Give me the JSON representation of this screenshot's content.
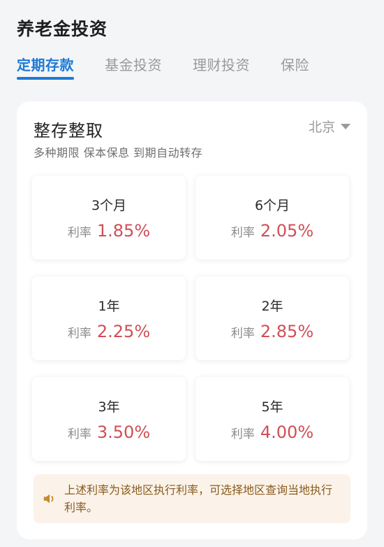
{
  "page": {
    "title": "养老金投资"
  },
  "tabs": [
    {
      "label": "定期存款",
      "active": true
    },
    {
      "label": "基金投资",
      "active": false
    },
    {
      "label": "理财投资",
      "active": false
    },
    {
      "label": "保险",
      "active": false
    }
  ],
  "card": {
    "title": "整存整取",
    "subtitle": "多种期限 保本保息 到期自动转存",
    "region": "北京"
  },
  "rates": [
    {
      "term": "3个月",
      "label": "利率",
      "value": "1.85%"
    },
    {
      "term": "6个月",
      "label": "利率",
      "value": "2.05%"
    },
    {
      "term": "1年",
      "label": "利率",
      "value": "2.25%"
    },
    {
      "term": "2年",
      "label": "利率",
      "value": "2.85%"
    },
    {
      "term": "3年",
      "label": "利率",
      "value": "3.50%"
    },
    {
      "term": "5年",
      "label": "利率",
      "value": "4.00%"
    }
  ],
  "notice": {
    "text": "上述利率为该地区执行利率，可选择地区查询当地执行利率。"
  },
  "colors": {
    "accent": "#1d7ad6",
    "rate": "#cf4f57",
    "notice_bg": "#fbf3ea",
    "notice_text": "#8a5a1c",
    "speaker_icon": "#c88a2c"
  }
}
